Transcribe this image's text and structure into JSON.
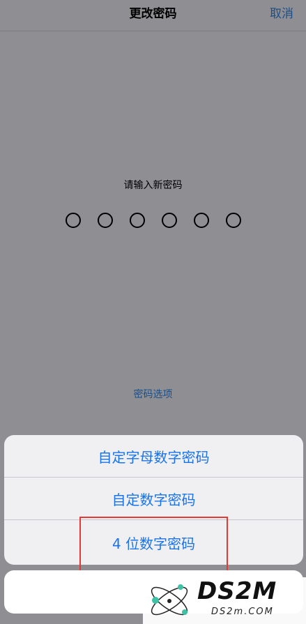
{
  "navbar": {
    "title": "更改密码",
    "cancel_label": "取消"
  },
  "passcode": {
    "prompt": "请输入新密码",
    "digits": 6,
    "options_label": "密码选项"
  },
  "action_sheet": {
    "items": [
      {
        "label": "自定字母数字密码"
      },
      {
        "label": "自定数字密码"
      },
      {
        "label": "4 位数字密码"
      }
    ]
  },
  "watermark": {
    "brand": "DS2M",
    "domain": "DS2m.COM"
  },
  "colors": {
    "accent": "#1a73e8",
    "dim_background": "#8e8e93",
    "highlight": "#e53935"
  }
}
